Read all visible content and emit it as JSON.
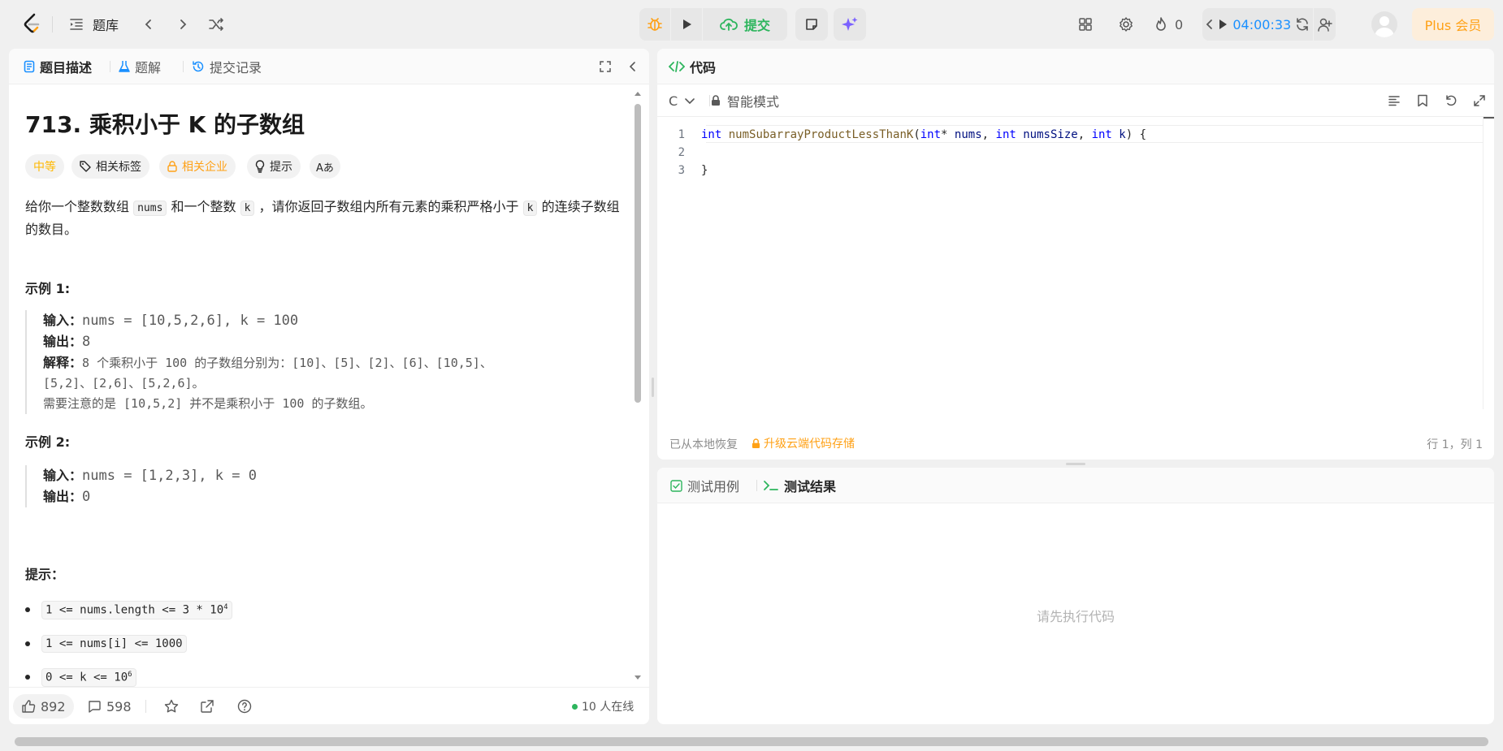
{
  "topbar": {
    "problem_bank_label": "题库",
    "submit_label": "提交",
    "streak_count": "0",
    "timer": "04:00:33",
    "plus_label": "Plus 会员"
  },
  "left_panel": {
    "tabs": [
      "题目描述",
      "题解",
      "提交记录"
    ],
    "title": "713. 乘积小于 K 的子数组",
    "tags": {
      "difficulty": "中等",
      "related_tags": "相关标签",
      "companies": "相关企业",
      "hint": "提示",
      "translate": "Aあ"
    },
    "description": {
      "p1_a": "给你一个整数数组",
      "p1_code1": "nums",
      "p1_b": "和一个整数",
      "p1_code2": "k",
      "p1_c": "，请你返回子数组内所有元素的乘积严格小于",
      "p1_code3": "k",
      "p1_d": "的连续子数组的数目。"
    },
    "example1": {
      "heading": "示例 1:",
      "input_label": "输入：",
      "input": "nums = [10,5,2,6], k = 100",
      "output_label": "输出：",
      "output": "8",
      "explain_label": "解释：",
      "explain_1": "8 个乘积小于 100 的子数组分别为：[10]、[5]、[2]、[6]、[10,5]、",
      "explain_2": "[5,2]、[2,6]、[5,2,6]。",
      "explain_3": "需要注意的是 [10,5,2] 并不是乘积小于 100 的子数组。"
    },
    "example2": {
      "heading": "示例 2:",
      "input_label": "输入：",
      "input": "nums = [1,2,3], k = 0",
      "output_label": "输出：",
      "output": "0"
    },
    "hints_heading": "提示：",
    "constraints": [
      {
        "text": "1 <= nums.length <= 3 * 10",
        "sup": "4"
      },
      {
        "text": "1 <= nums[i] <= 1000",
        "sup": ""
      },
      {
        "text": "0 <= k <= 10",
        "sup": "6"
      }
    ],
    "footer": {
      "likes": "892",
      "comments": "598",
      "online": "10 人在线"
    }
  },
  "code_panel": {
    "title": "代码",
    "language": "C",
    "mode": "智能模式",
    "lines": [
      "1",
      "2",
      "3"
    ],
    "code": {
      "kw_int1": "int",
      "fn_name": "numSubarrayProductLessThanK",
      "paren_open": "(",
      "kw_int2": "int",
      "star": "*",
      "p_nums": "nums",
      "comma1": ",",
      "kw_int3": "int",
      "p_size": "numsSize",
      "comma2": ",",
      "kw_int4": "int",
      "p_k": "k",
      "close": ") {",
      "end": "}"
    },
    "status_left": "已从本地恢复",
    "status_upgrade": "升级云端代码存储",
    "cursor_pos": "行 1，列 1"
  },
  "test_panel": {
    "tabs": [
      "测试用例",
      "测试结果"
    ],
    "empty_text": "请先执行代码"
  },
  "colors": {
    "accent_green": "#2db55d",
    "accent_blue": "#1a90ff",
    "orange": "#ffa116",
    "plus_bg": "#fdeedb"
  }
}
